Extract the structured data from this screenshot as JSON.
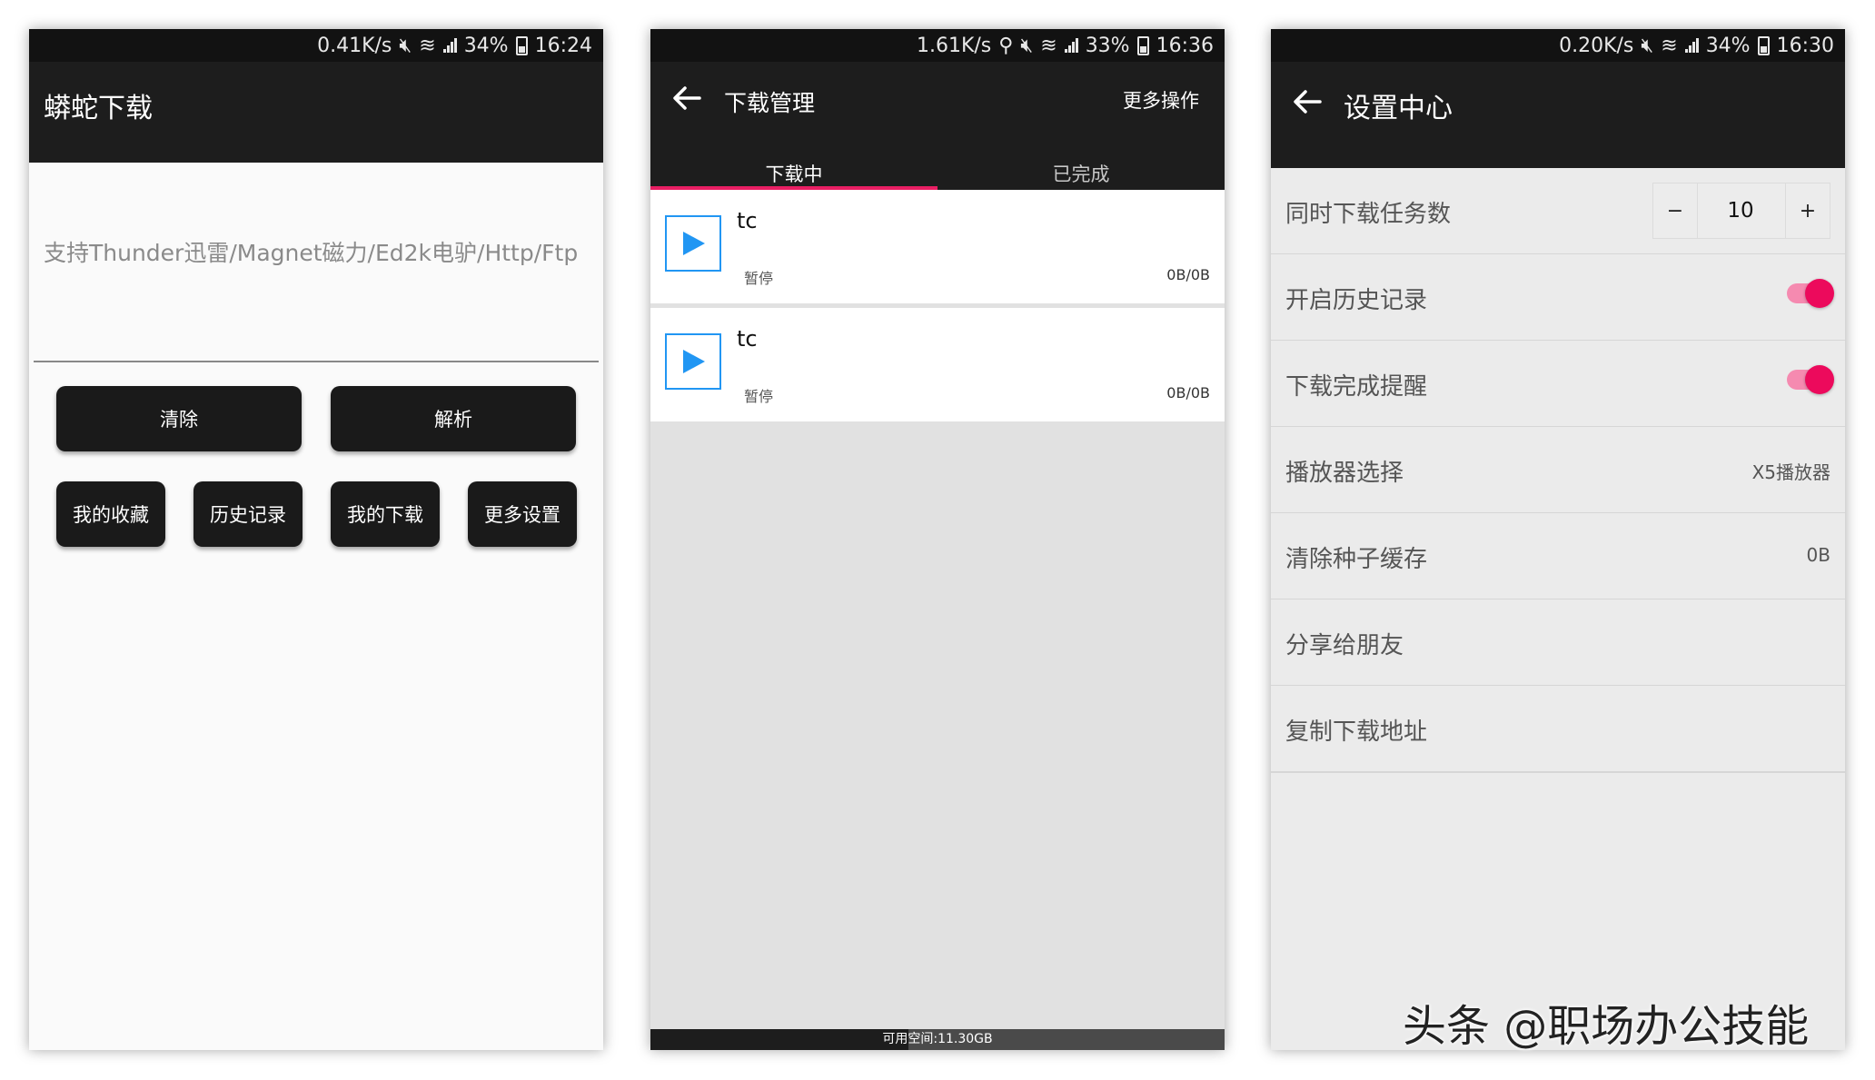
{
  "screen1": {
    "status": {
      "speed": "0.41K/s",
      "battery": "34%",
      "time": "16:24"
    },
    "title": "蟒蛇下载",
    "input_placeholder": "支持Thunder迅雷/Magnet磁力/Ed2k电驴/Http/Ftp",
    "buttons": {
      "clear": "清除",
      "parse": "解析",
      "favorites": "我的收藏",
      "history": "历史记录",
      "downloads": "我的下载",
      "settings": "更多设置"
    }
  },
  "screen2": {
    "status": {
      "speed": "1.61K/s",
      "battery": "33%",
      "time": "16:36"
    },
    "title": "下载管理",
    "more_ops": "更多操作",
    "tabs": [
      "下载中",
      "已完成"
    ],
    "items": [
      {
        "name": "tc",
        "status": "暂停",
        "size": "0B/0B"
      },
      {
        "name": "tc",
        "status": "暂停",
        "size": "0B/0B"
      }
    ],
    "storage_text": "可用空间:11.30GB",
    "storage_used_fraction": 0.45
  },
  "screen3": {
    "status": {
      "speed": "0.20K/s",
      "battery": "34%",
      "time": "16:30"
    },
    "title": "设置中心",
    "rows": {
      "concurrent": {
        "label": "同时下载任务数",
        "value": "10",
        "minus": "−",
        "plus": "+"
      },
      "history": {
        "label": "开启历史记录",
        "on": true
      },
      "notify": {
        "label": "下载完成提醒",
        "on": true
      },
      "player": {
        "label": "播放器选择",
        "value": "X5播放器"
      },
      "cache": {
        "label": "清除种子缓存",
        "value": "0B"
      },
      "share": {
        "label": "分享给朋友"
      },
      "copy": {
        "label": "复制下载地址"
      }
    }
  },
  "watermark": "头条 @职场办公技能",
  "colors": {
    "accent": "#e91e63",
    "play": "#2196f3",
    "toggle": "#ec0a5c"
  }
}
